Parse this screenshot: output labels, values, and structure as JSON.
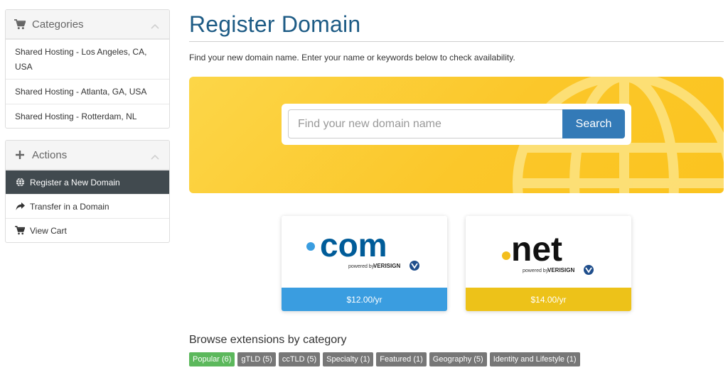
{
  "sidebar": {
    "categories": {
      "title": "Categories",
      "items": [
        {
          "label": "Shared Hosting - Los Angeles, CA, USA"
        },
        {
          "label": "Shared Hosting - Atlanta, GA, USA"
        },
        {
          "label": "Shared Hosting - Rotterdam, NL"
        }
      ]
    },
    "actions": {
      "title": "Actions",
      "items": [
        {
          "label": "Register a New Domain",
          "icon": "globe-icon",
          "active": true
        },
        {
          "label": "Transfer in a Domain",
          "icon": "share-arrow-icon"
        },
        {
          "label": "View Cart",
          "icon": "cart-icon"
        }
      ]
    }
  },
  "main": {
    "title": "Register Domain",
    "subtitle": "Find your new domain name. Enter your name or keywords below to check availability.",
    "search": {
      "placeholder": "Find your new domain name",
      "value": "",
      "button_label": "Search"
    },
    "featured_tlds": [
      {
        "tld": ".com",
        "logo_text": "com",
        "powered_by": "powered by",
        "brand": "VERISIGN",
        "price": "$12.00/yr",
        "price_color": "#3a9de0",
        "dot_color": "#3a9de0",
        "text_color": "#005c99"
      },
      {
        "tld": ".net",
        "logo_text": "net",
        "powered_by": "powered by",
        "brand": "VERISIGN",
        "price": "$14.00/yr",
        "price_color": "#edc219",
        "dot_color": "#f3be1c",
        "text_color": "#111111"
      }
    ],
    "browse": {
      "title": "Browse extensions by category",
      "categories": [
        {
          "label": "Popular (6)",
          "active": true
        },
        {
          "label": "gTLD (5)"
        },
        {
          "label": "ccTLD (5)"
        },
        {
          "label": "Specialty (1)"
        },
        {
          "label": "Featured (1)"
        },
        {
          "label": "Geography (5)"
        },
        {
          "label": "Identity and Lifestyle (1)"
        }
      ]
    }
  },
  "colors": {
    "accent": "#337ab7",
    "title": "#1d5b85",
    "hero": "#fbc72a",
    "active_nav": "#414a4f",
    "chip": "#777777",
    "chip_active": "#5cb85c"
  }
}
